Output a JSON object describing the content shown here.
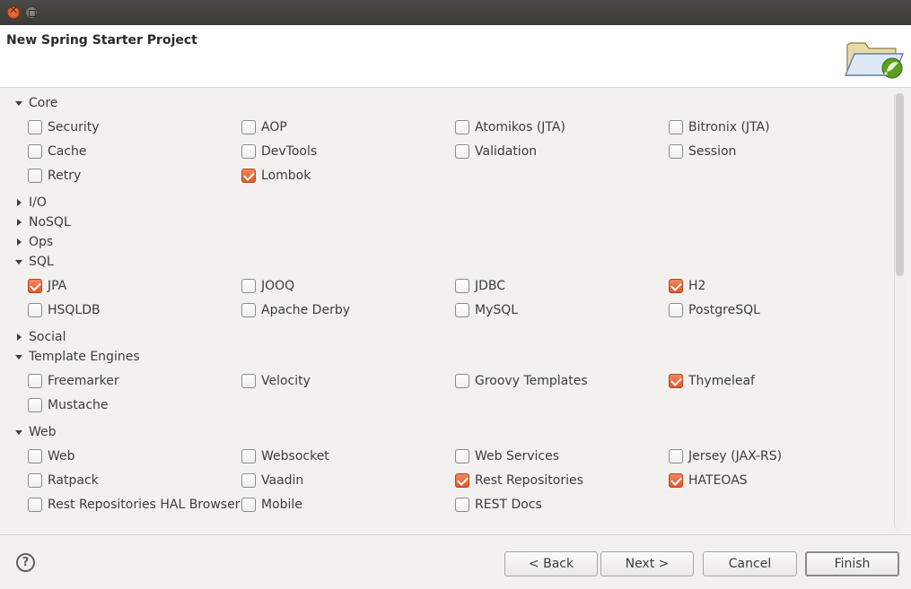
{
  "window": {
    "title": "New Spring Starter Project",
    "header_icon": "folder-spring-icon"
  },
  "groups": [
    {
      "label": "Core",
      "expanded": true,
      "items": [
        {
          "label": "Security",
          "checked": false
        },
        {
          "label": "AOP",
          "checked": false
        },
        {
          "label": "Atomikos (JTA)",
          "checked": false
        },
        {
          "label": "Bitronix (JTA)",
          "checked": false
        },
        {
          "label": "Cache",
          "checked": false
        },
        {
          "label": "DevTools",
          "checked": false
        },
        {
          "label": "Validation",
          "checked": false
        },
        {
          "label": "Session",
          "checked": false
        },
        {
          "label": "Retry",
          "checked": false
        },
        {
          "label": "Lombok",
          "checked": true
        }
      ]
    },
    {
      "label": "I/O",
      "expanded": false,
      "items": []
    },
    {
      "label": "NoSQL",
      "expanded": false,
      "items": []
    },
    {
      "label": "Ops",
      "expanded": false,
      "items": []
    },
    {
      "label": "SQL",
      "expanded": true,
      "items": [
        {
          "label": "JPA",
          "checked": true
        },
        {
          "label": "JOOQ",
          "checked": false
        },
        {
          "label": "JDBC",
          "checked": false
        },
        {
          "label": "H2",
          "checked": true
        },
        {
          "label": "HSQLDB",
          "checked": false
        },
        {
          "label": "Apache Derby",
          "checked": false
        },
        {
          "label": "MySQL",
          "checked": false
        },
        {
          "label": "PostgreSQL",
          "checked": false
        }
      ]
    },
    {
      "label": "Social",
      "expanded": false,
      "items": []
    },
    {
      "label": "Template Engines",
      "expanded": true,
      "items": [
        {
          "label": "Freemarker",
          "checked": false
        },
        {
          "label": "Velocity",
          "checked": false
        },
        {
          "label": "Groovy Templates",
          "checked": false
        },
        {
          "label": "Thymeleaf",
          "checked": true
        },
        {
          "label": "Mustache",
          "checked": false
        }
      ]
    },
    {
      "label": "Web",
      "expanded": true,
      "items": [
        {
          "label": "Web",
          "checked": false
        },
        {
          "label": "Websocket",
          "checked": false
        },
        {
          "label": "Web Services",
          "checked": false
        },
        {
          "label": "Jersey (JAX-RS)",
          "checked": false
        },
        {
          "label": "Ratpack",
          "checked": false
        },
        {
          "label": "Vaadin",
          "checked": false
        },
        {
          "label": "Rest Repositories",
          "checked": true
        },
        {
          "label": "HATEOAS",
          "checked": true
        },
        {
          "label": "Rest Repositories HAL Browser",
          "checked": false
        },
        {
          "label": "Mobile",
          "checked": false
        },
        {
          "label": "REST Docs",
          "checked": false
        }
      ]
    }
  ],
  "footer": {
    "help": "?",
    "back": "< Back",
    "next": "Next >",
    "cancel": "Cancel",
    "finish": "Finish"
  },
  "colors": {
    "checked": "#e0582a",
    "header_bg": "#ffffff",
    "dialog_bg": "#f2f1f0",
    "titlebar": "#3b3a36"
  }
}
